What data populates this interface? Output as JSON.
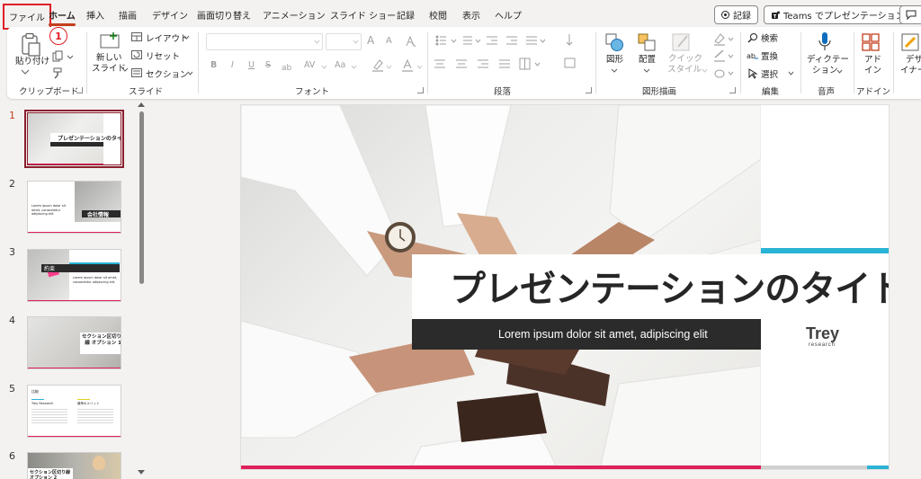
{
  "menu": {
    "tabs": [
      "ファイル",
      "ホーム",
      "挿入",
      "描画",
      "デザイン",
      "画面切り替え",
      "アニメーション",
      "スライド ショー",
      "記録",
      "校閲",
      "表示",
      "ヘルプ"
    ],
    "record_button": "記録",
    "teams_button": "Teams でプレゼンテーション"
  },
  "callout": "1",
  "ribbon": {
    "clipboard": {
      "paste": "貼り付け",
      "label": "クリップボード"
    },
    "slides": {
      "new_slide_1": "新しい",
      "new_slide_2": "スライド",
      "layout": "レイアウト",
      "reset": "リセット",
      "section": "セクション",
      "label": "スライド"
    },
    "font": {
      "label": "フォント",
      "bold": "B",
      "italic": "I",
      "underline": "U",
      "strike": "S",
      "spacing": "AV",
      "case": "Aa",
      "grow": "A",
      "shrink": "A"
    },
    "paragraph": {
      "label": "段落"
    },
    "drawing": {
      "shape": "図形",
      "arrange": "配置",
      "quick_1": "クイック",
      "quick_2": "スタイル",
      "label": "図形描画"
    },
    "editing": {
      "find": "検索",
      "replace": "置換",
      "select": "選択",
      "label": "編集"
    },
    "voice": {
      "dictate_1": "ディクテー",
      "dictate_2": "ション",
      "label": "音声"
    },
    "addins": {
      "addin_1": "アド",
      "addin_2": "イン",
      "label": "アドイン"
    },
    "designer": {
      "designer_1": "デザ",
      "designer_2": "イナー"
    }
  },
  "thumbnails": [
    {
      "num": "1",
      "title": "プレゼンテーションのタイトル"
    },
    {
      "num": "2",
      "title": "会社情報",
      "body": "Lorem ipsum dolor sit amet, consectetur adipiscing elit."
    },
    {
      "num": "3",
      "title": "約束",
      "body": "Lorem ipsum dolor sit amet, consectetur adipiscing elit."
    },
    {
      "num": "4",
      "title": "セクション区切り線 オプション 1"
    },
    {
      "num": "5",
      "title": "比較",
      "body_left": "Trey Research",
      "body_right": "競争のメリット"
    },
    {
      "num": "6",
      "title": "セクション区切り線 オプション 2"
    }
  ],
  "slide": {
    "title": "プレゼンテーションのタイトル",
    "subtitle": "Lorem ipsum dolor sit amet, adipiscing elit",
    "logo": "Trey",
    "logo_sub": "research"
  },
  "colors": {
    "accent": "#c43e1c",
    "highlight": "#e01f26",
    "pink": "#e0205b",
    "cyan": "#2ab3d5"
  }
}
